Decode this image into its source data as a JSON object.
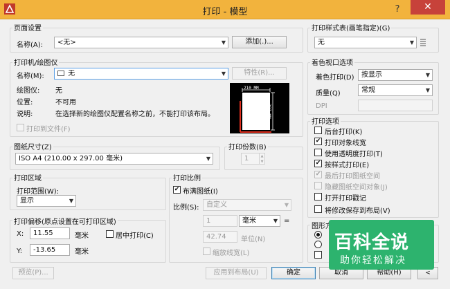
{
  "window": {
    "title": "打印 - 模型",
    "help_glyph": "?",
    "close_glyph": "✕"
  },
  "page_setup": {
    "group_label": "页面设置",
    "name_label": "名称(A):",
    "name_value": "<无>",
    "add_button": "添加(.)..."
  },
  "printer": {
    "group_label": "打印机/绘图仪",
    "name_label": "名称(M):",
    "name_value": "无",
    "properties_button": "特性(R)...",
    "plotter_label": "绘图仪:",
    "plotter_value": "无",
    "location_label": "位置:",
    "location_value": "不可用",
    "description_label": "说明:",
    "description_value": "在选择新的绘图仪配置名称之前，不能打印该布局。",
    "print_to_file": "打印到文件(F)",
    "preview_width": "210 MM",
    "preview_height": "297 MM"
  },
  "paper_size": {
    "group_label": "图纸尺寸(Z)",
    "value": "ISO A4 (210.00 x 297.00 毫米)"
  },
  "copies": {
    "group_label": "打印份数(B)",
    "value": "1"
  },
  "plot_area": {
    "group_label": "打印区域",
    "range_label": "打印范围(W):",
    "range_value": "显示"
  },
  "plot_offset": {
    "group_label": "打印偏移(原点设置在可打印区域)",
    "x_label": "X:",
    "x_value": "11.55",
    "x_unit": "毫米",
    "y_label": "Y:",
    "y_value": "-13.65",
    "y_unit": "毫米",
    "center_label": "居中打印(C)"
  },
  "plot_scale": {
    "group_label": "打印比例",
    "fit_label": "布满图纸(I)",
    "scale_label": "比例(S):",
    "scale_value": "自定义",
    "top_value": "1",
    "unit_value": "毫米",
    "equals": "=",
    "bottom_value": "42.74",
    "units_label": "单位(N)",
    "lineweights_label": "缩放线宽(L)"
  },
  "style_table": {
    "group_label": "打印样式表(画笔指定)(G)",
    "value": "无"
  },
  "shaded_viewport": {
    "group_label": "着色视口选项",
    "shade_label": "着色打印(D)",
    "shade_value": "按显示",
    "quality_label": "质量(Q)",
    "quality_value": "常规",
    "dpi_label": "DPI"
  },
  "plot_options": {
    "group_label": "打印选项",
    "items": [
      {
        "label": "后台打印(K)",
        "mark": "",
        "disabled": false
      },
      {
        "label": "打印对象线宽",
        "mark": "✔",
        "disabled": false
      },
      {
        "label": "使用透明度打印(T)",
        "mark": "",
        "disabled": false
      },
      {
        "label": "按样式打印(E)",
        "mark": "✔",
        "disabled": false
      },
      {
        "label": "最后打印图纸空间",
        "mark": "✔",
        "disabled": true
      },
      {
        "label": "隐藏图纸空间对象(J)",
        "mark": "",
        "disabled": true
      },
      {
        "label": "打开打印戳记",
        "mark": "",
        "disabled": false
      },
      {
        "label": "将修改保存到布局(V)",
        "mark": "",
        "disabled": false
      }
    ]
  },
  "orientation": {
    "group_label": "图形方向"
  },
  "buttons": {
    "preview": "预览(P)...",
    "apply": "应用到布局(U)",
    "ok": "确定",
    "cancel": "取消",
    "help": "帮助(H)"
  },
  "watermark": {
    "title": "百科全说",
    "subtitle": "助你轻松解决"
  },
  "colors": {
    "titlebar": "#f2b33d",
    "close": "#c7423a",
    "watermark": "#2db36e"
  }
}
